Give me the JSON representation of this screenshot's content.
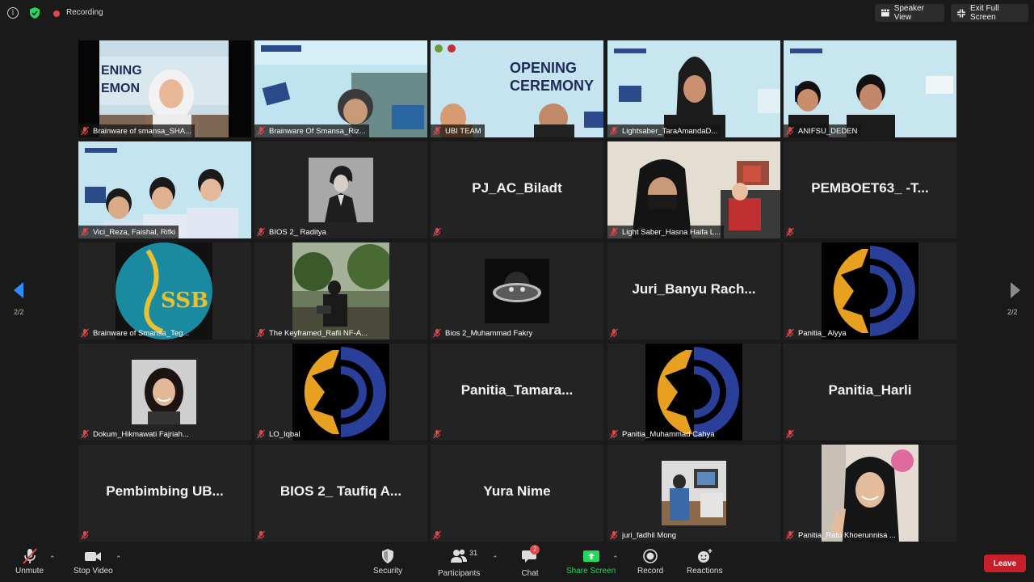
{
  "topbar": {
    "recording_label": "Recording",
    "speaker_view_label": "Speaker View",
    "exit_fullscreen_label": "Exit Full Screen"
  },
  "pagination": {
    "left": "2/2",
    "right": "2/2"
  },
  "tiles": [
    {
      "name": "Brainware of smansa_SHA...",
      "kind": "video"
    },
    {
      "name": "Brainware Of Smansa_Riz...",
      "kind": "video"
    },
    {
      "name": "UBI TEAM",
      "kind": "video"
    },
    {
      "name": "Lightsaber_TaraAmandaD...",
      "kind": "video"
    },
    {
      "name": "ANIFSU_DEDEN",
      "kind": "video"
    },
    {
      "name": "Vici_Reza, Faishal, Rifki",
      "kind": "video"
    },
    {
      "name": "BIOS 2_ Raditya",
      "kind": "avatar"
    },
    {
      "name": "PJ_AC_Biladt",
      "kind": "text"
    },
    {
      "name": "Light Saber_Hasna Haifa L...",
      "kind": "video"
    },
    {
      "name": "PEMBOET63_ -T...",
      "kind": "text"
    },
    {
      "name": "Brainware of Smansa_Teg...",
      "kind": "avatar"
    },
    {
      "name": "The Keyframed_Rafli NF-A...",
      "kind": "avatar"
    },
    {
      "name": "Bios 2_Muhammad Fakry",
      "kind": "avatar"
    },
    {
      "name": "Juri_Banyu Rach...",
      "kind": "text"
    },
    {
      "name": "Panitia_ Alyya",
      "kind": "avatar"
    },
    {
      "name": "Dokum_Hikmawati Fajriah...",
      "kind": "avatar"
    },
    {
      "name": "LO_Iqbal",
      "kind": "avatar"
    },
    {
      "name": "Panitia_Tamara...",
      "kind": "text"
    },
    {
      "name": "Panitia_Muhammad Cahya",
      "kind": "avatar"
    },
    {
      "name": "Panitia_Harli",
      "kind": "text"
    },
    {
      "name": "Pembimbing UB...",
      "kind": "text"
    },
    {
      "name": "BIOS 2_ Taufiq A...",
      "kind": "text"
    },
    {
      "name": "Yura Nime",
      "kind": "text"
    },
    {
      "name": "juri_fadhil Mong",
      "kind": "avatar"
    },
    {
      "name": "Panitia_Ratu Khoerunnisa ...",
      "kind": "avatar"
    }
  ],
  "toolbar": {
    "unmute_label": "Unmute",
    "stop_video_label": "Stop Video",
    "security_label": "Security",
    "participants_label": "Participants",
    "participants_count": "31",
    "chat_label": "Chat",
    "chat_badge": "2",
    "share_screen_label": "Share Screen",
    "record_label": "Record",
    "reactions_label": "Reactions",
    "leave_label": "Leave"
  },
  "colors": {
    "background": "#1a1a1a",
    "tile": "#232323",
    "accent_blue": "#2d8cff",
    "share_green": "#23d959",
    "leave_red": "#c8202a",
    "mute_red": "#e0484a"
  },
  "icons": [
    "info-icon",
    "shield-icon",
    "speaker-view-icon",
    "exit-fullscreen-icon",
    "mic-off-icon",
    "video-icon",
    "security-icon",
    "participants-icon",
    "chat-icon",
    "share-screen-icon",
    "record-icon",
    "reactions-icon"
  ]
}
